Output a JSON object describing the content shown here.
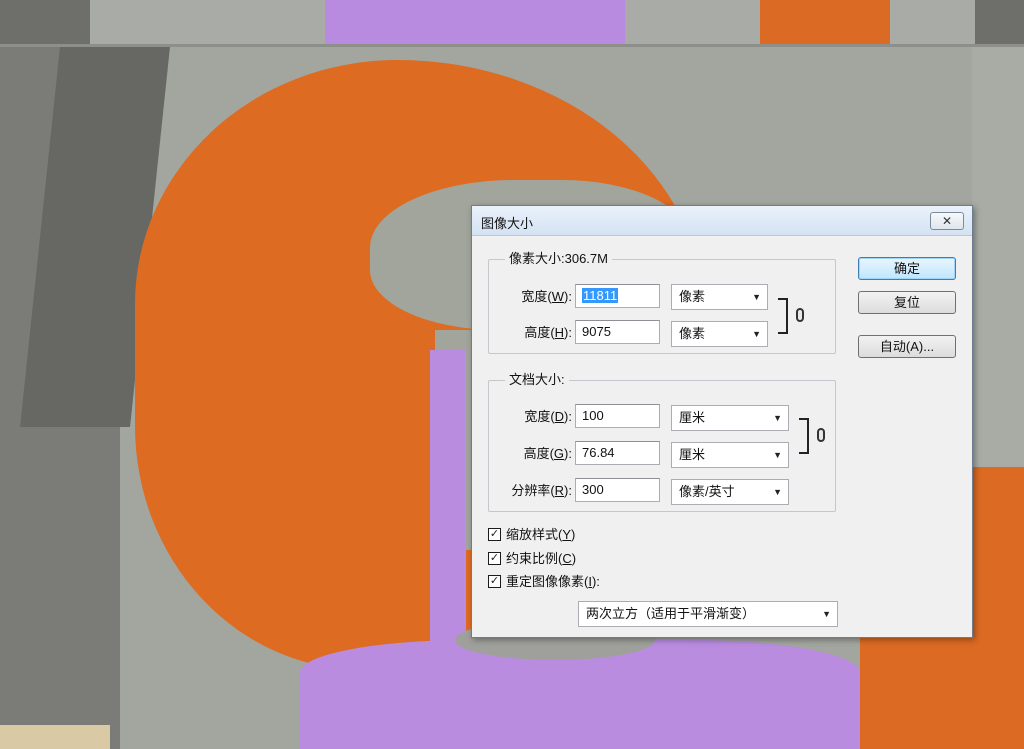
{
  "dialog": {
    "title": "图像大小",
    "close_symbol": "✕"
  },
  "pixel_dimensions": {
    "label": "像素大小:306.7M",
    "width_label_pre": "宽度(",
    "width_key": "W",
    "width_label_post": "):",
    "width_value": "11811",
    "width_unit": "像素",
    "height_label_pre": "高度(",
    "height_key": "H",
    "height_label_post": "):",
    "height_value": "9075",
    "height_unit": "像素"
  },
  "document_size": {
    "label": "文档大小:",
    "width_label_pre": "宽度(",
    "width_key": "D",
    "width_label_post": "):",
    "width_value": "100",
    "width_unit": "厘米",
    "height_label_pre": "高度(",
    "height_key": "G",
    "height_label_post": "):",
    "height_value": "76.84",
    "height_unit": "厘米",
    "resolution_label_pre": "分辨率(",
    "resolution_key": "R",
    "resolution_label_post": "):",
    "resolution_value": "300",
    "resolution_unit": "像素/英寸"
  },
  "buttons": {
    "ok": "确定",
    "reset": "复位",
    "auto": "自动(A)..."
  },
  "options": {
    "scale_styles_pre": "缩放样式(",
    "scale_styles_key": "Y",
    "scale_styles_post": ")",
    "scale_styles_checked": true,
    "constrain_pre": "约束比例(",
    "constrain_key": "C",
    "constrain_post": ")",
    "constrain_checked": true,
    "resample_pre": "重定图像像素(",
    "resample_key": "I",
    "resample_post": "):",
    "resample_checked": true,
    "resample_method": "两次立方（适用于平滑渐变）"
  },
  "icons": {
    "check": "✓",
    "dropdown": "▼"
  }
}
